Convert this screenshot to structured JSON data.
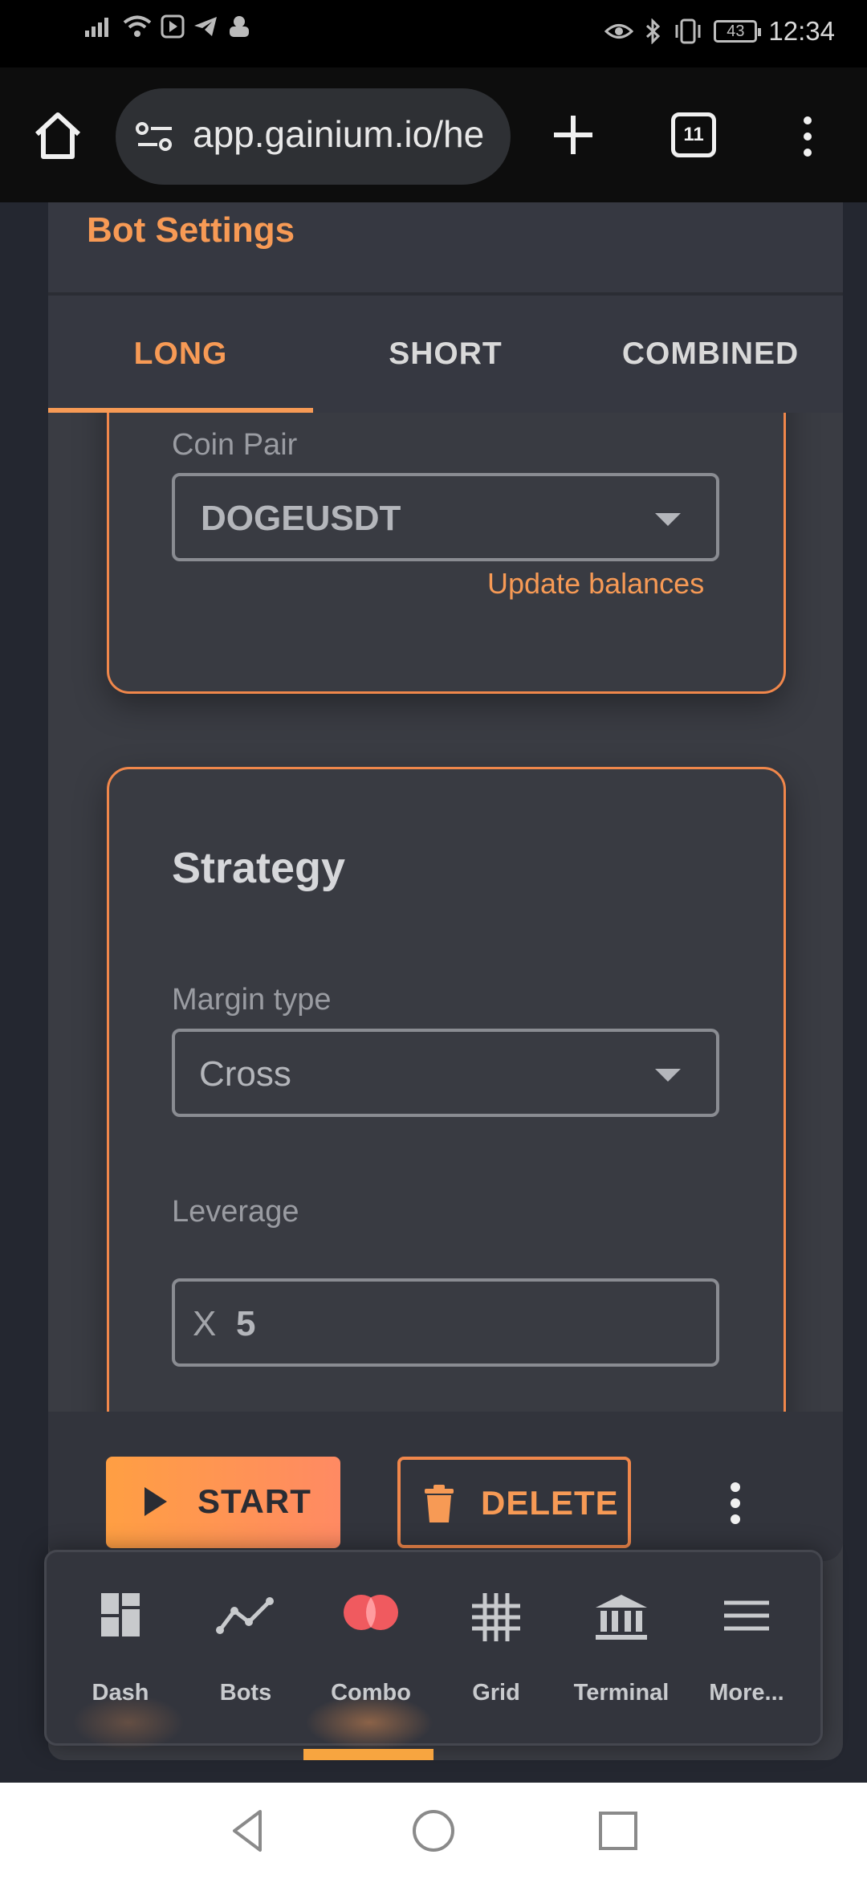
{
  "status_bar": {
    "time": "12:34",
    "battery": "43"
  },
  "browser": {
    "url": "app.gainium.io/he",
    "tab_count": "11"
  },
  "header": {
    "title": "Bot Settings"
  },
  "tabs": [
    {
      "label": "LONG",
      "active": true
    },
    {
      "label": "SHORT",
      "active": false
    },
    {
      "label": "COMBINED",
      "active": false
    }
  ],
  "coin_section": {
    "label": "Coin Pair",
    "value": "DOGEUSDT",
    "update_link": "Update balances"
  },
  "strategy": {
    "title": "Strategy",
    "margin_label": "Margin type",
    "margin_value": "Cross",
    "leverage_label": "Leverage",
    "leverage_prefix": "X",
    "leverage_value": "5"
  },
  "actions": {
    "start": "START",
    "delete": "DELETE"
  },
  "app_nav": [
    {
      "label": "Dash",
      "icon": "dashboard-icon"
    },
    {
      "label": "Bots",
      "icon": "line-chart-icon"
    },
    {
      "label": "Combo",
      "icon": "combo-icon",
      "active": true
    },
    {
      "label": "Grid",
      "icon": "grid-icon"
    },
    {
      "label": "Terminal",
      "icon": "bank-icon"
    },
    {
      "label": "More...",
      "icon": "menu-icon"
    }
  ],
  "colors": {
    "accent": "#f79a55",
    "card_border": "#f0874b",
    "combo": "#f05a5f"
  }
}
